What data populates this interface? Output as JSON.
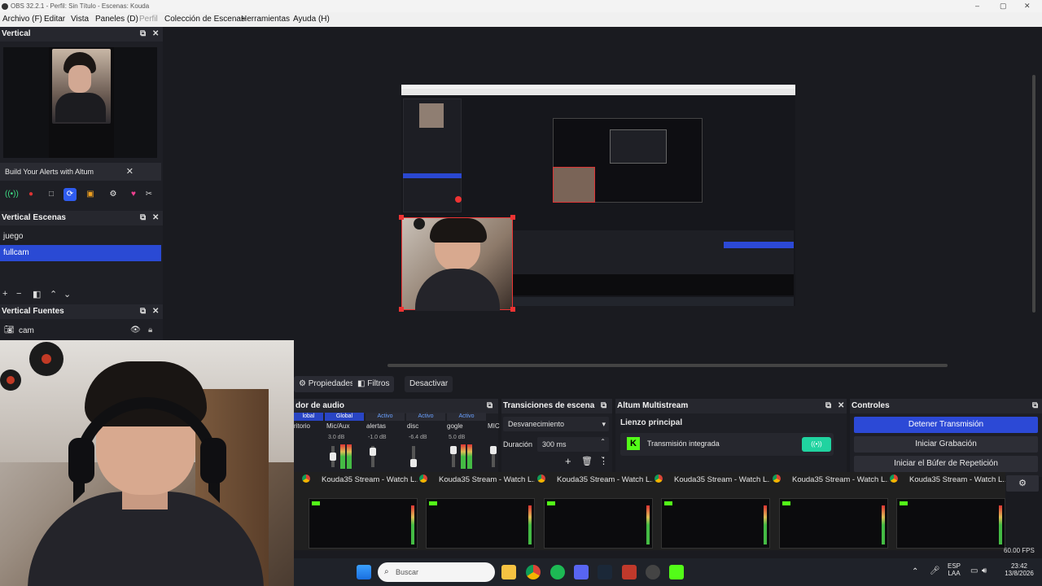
{
  "window": {
    "title": "OBS 32.2.1 - Perfil: Sin Título - Escenas: Kouda",
    "controls": [
      "–",
      "▢",
      "✕"
    ]
  },
  "menu": [
    "Archivo (F)",
    "Editar",
    "Vista",
    "Paneles (D)",
    "Perfil",
    "Colección de Escenas",
    "Herramientas",
    "Ayuda (H)"
  ],
  "vertical_dock": {
    "title": "Vertical",
    "alert_text": "Build Your Alerts with Altum",
    "alert_close": "✕"
  },
  "scenes_dock": {
    "title": "Vertical Escenas",
    "items": [
      "juego",
      "fullcam"
    ],
    "selected": "fullcam"
  },
  "sources_dock": {
    "title": "Vertical Fuentes",
    "items": [
      "cam"
    ]
  },
  "source_toolbar": {
    "properties": "Propiedades",
    "filters": "Filtros",
    "deactivate": "Desactivar"
  },
  "audio_mixer": {
    "title": "dor de audio",
    "tabs": [
      "lobal",
      "Global",
      "Activo",
      "Activo",
      "Activo"
    ],
    "channels": [
      "ritorio",
      "Mic/Aux",
      "alertas",
      "disc",
      "gogle",
      "MIC"
    ],
    "db": [
      "3.0 dB",
      "-1.0 dB",
      "-6.4 dB",
      "5.0 dB"
    ]
  },
  "transitions": {
    "title": "Transiciones de escena",
    "type": "Desvanecimiento",
    "duration_label": "Duración",
    "duration_value": "300 ms"
  },
  "multistream": {
    "title": "Altum Multistream",
    "canvas": "Lienzo principal",
    "target": "Transmisión integrada"
  },
  "controls": {
    "title": "Controles",
    "stop_stream": "Detener Transmisión",
    "start_recording": "Iniciar Grabación",
    "start_replay": "Iniciar el Búfer de Repetición"
  },
  "taskbar_tabs": [
    "Kouda35 Stream - Watch L...",
    "Kouda35 Stream - Watch L...",
    "Kouda35 Stream - Watch L...",
    "Kouda35 Stream - Watch L...",
    "Kouda35 Stream - Watch L...",
    "Kouda35 Stream - Watch L..."
  ],
  "taskbar": {
    "search": "Buscar",
    "lang": "ESP",
    "lang2": "LAA",
    "time": "23:42",
    "date": "13/8/2026"
  },
  "status": {
    "fps": "60.00 FPS"
  }
}
